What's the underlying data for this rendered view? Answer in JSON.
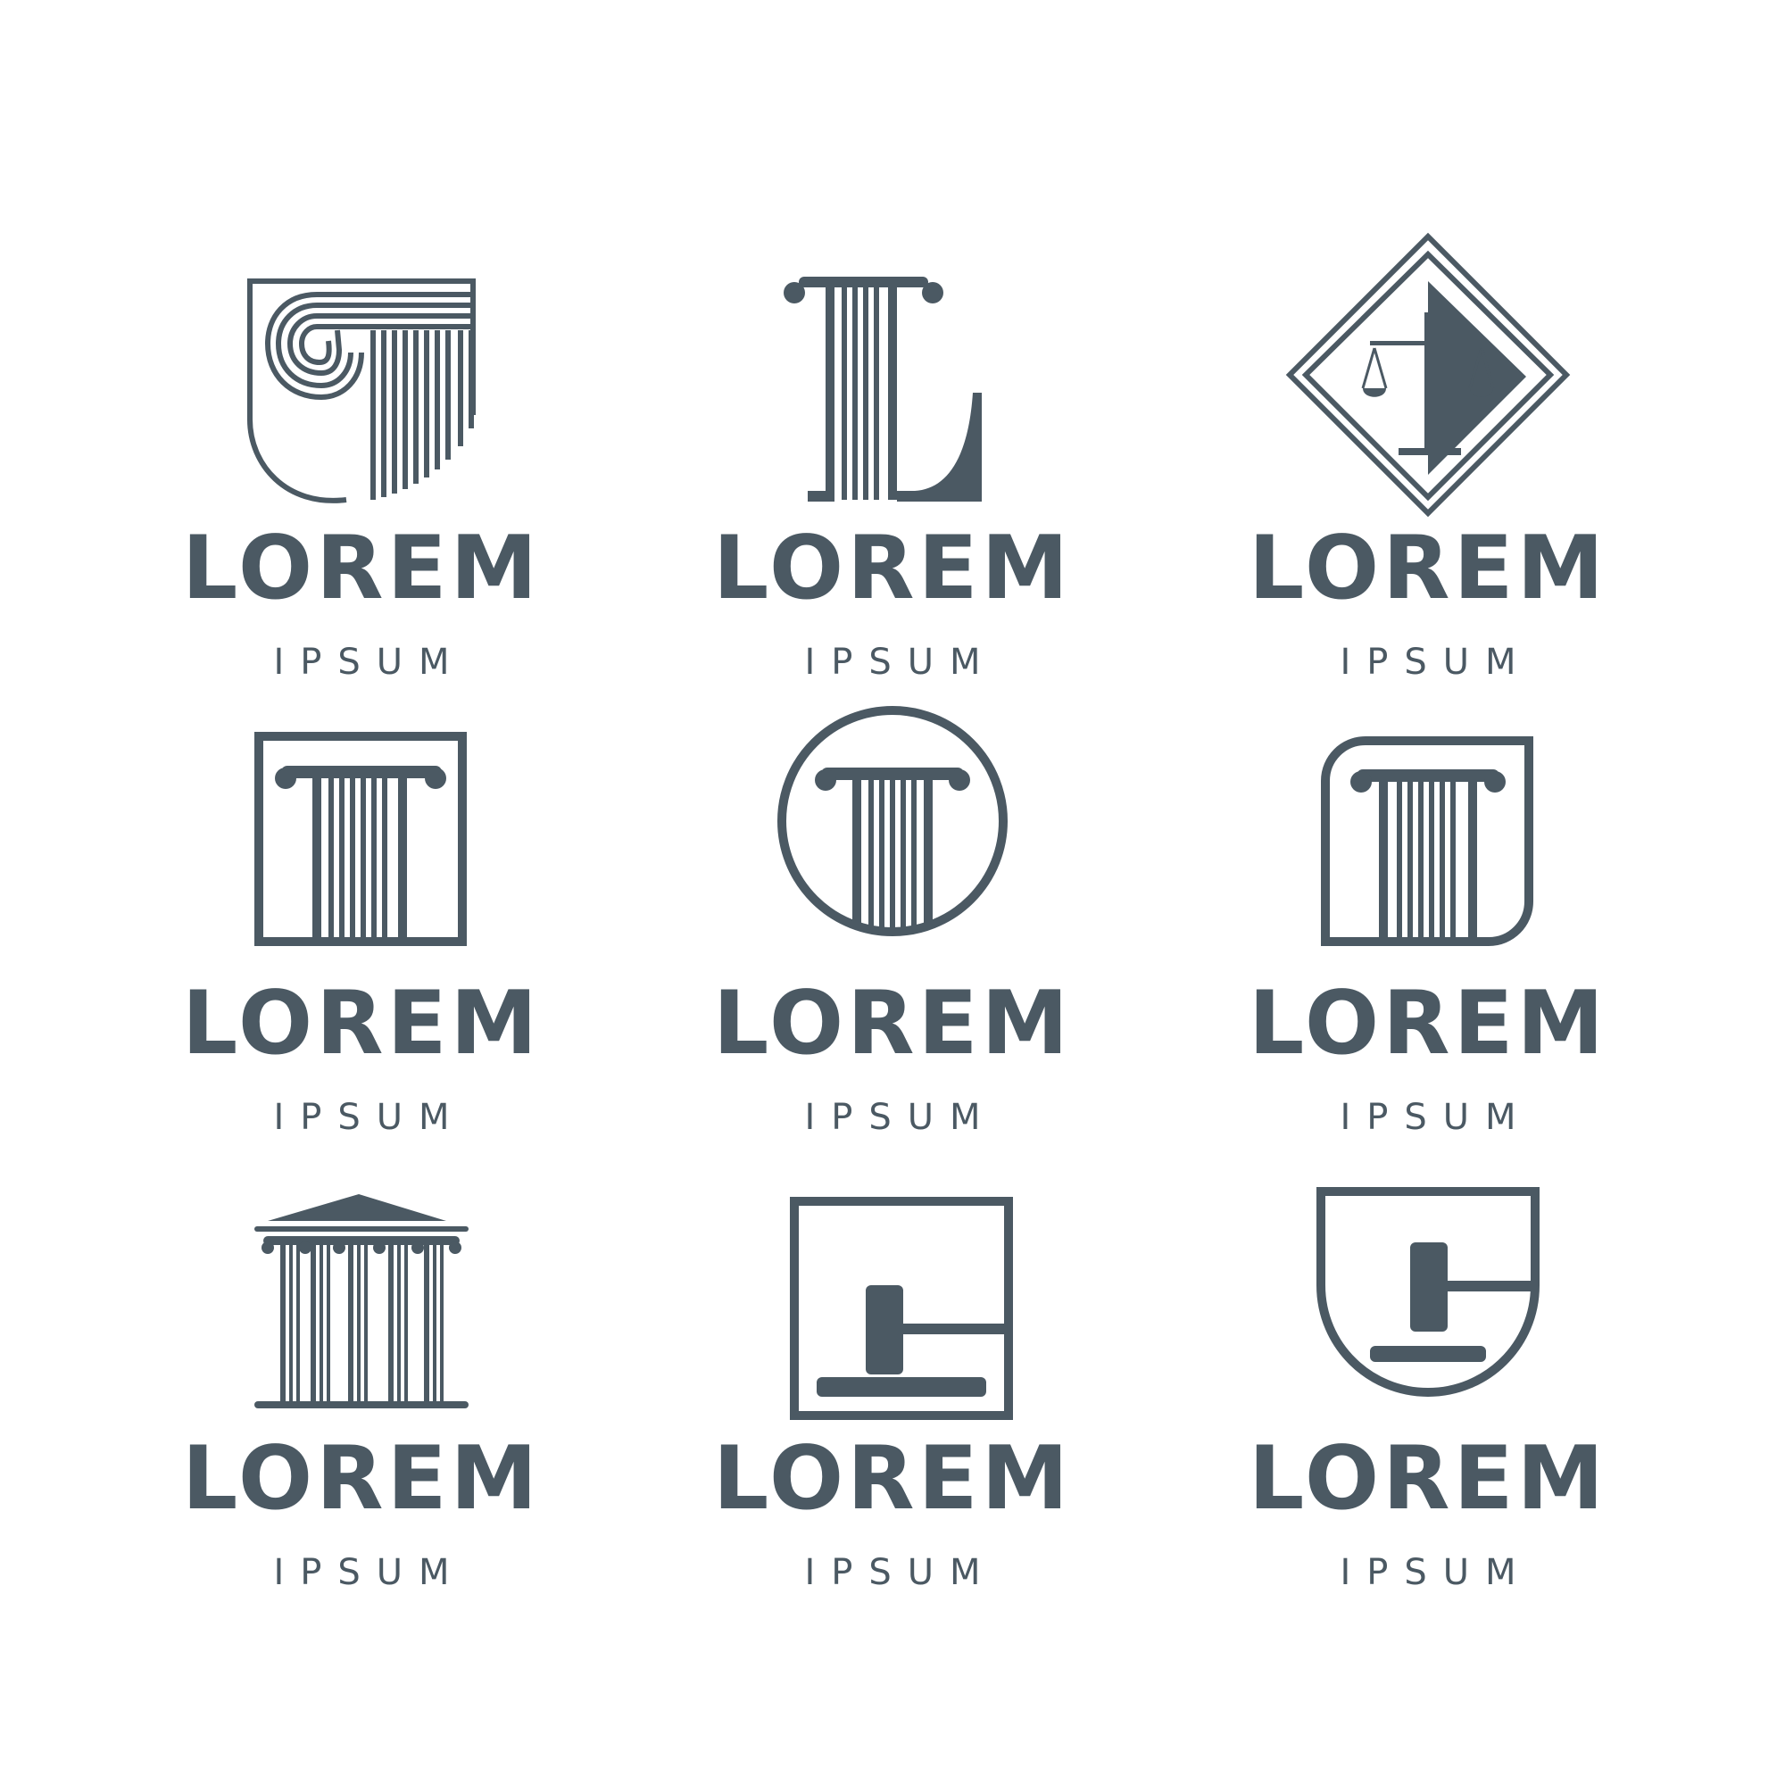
{
  "brand_color": "#4b5963",
  "logos": [
    {
      "name": "LOREM",
      "tagline": "IPSUM",
      "icon": "scroll-column-shield-icon"
    },
    {
      "name": "LOREM",
      "tagline": "IPSUM",
      "icon": "letter-l-column-icon"
    },
    {
      "name": "LOREM",
      "tagline": "IPSUM",
      "icon": "scales-diamond-icon"
    },
    {
      "name": "LOREM",
      "tagline": "IPSUM",
      "icon": "column-square-icon"
    },
    {
      "name": "LOREM",
      "tagline": "IPSUM",
      "icon": "column-circle-icon"
    },
    {
      "name": "LOREM",
      "tagline": "IPSUM",
      "icon": "column-rounded-square-icon"
    },
    {
      "name": "LOREM",
      "tagline": "IPSUM",
      "icon": "courthouse-icon"
    },
    {
      "name": "LOREM",
      "tagline": "IPSUM",
      "icon": "gavel-square-icon"
    },
    {
      "name": "LOREM",
      "tagline": "IPSUM",
      "icon": "gavel-shield-icon"
    }
  ]
}
